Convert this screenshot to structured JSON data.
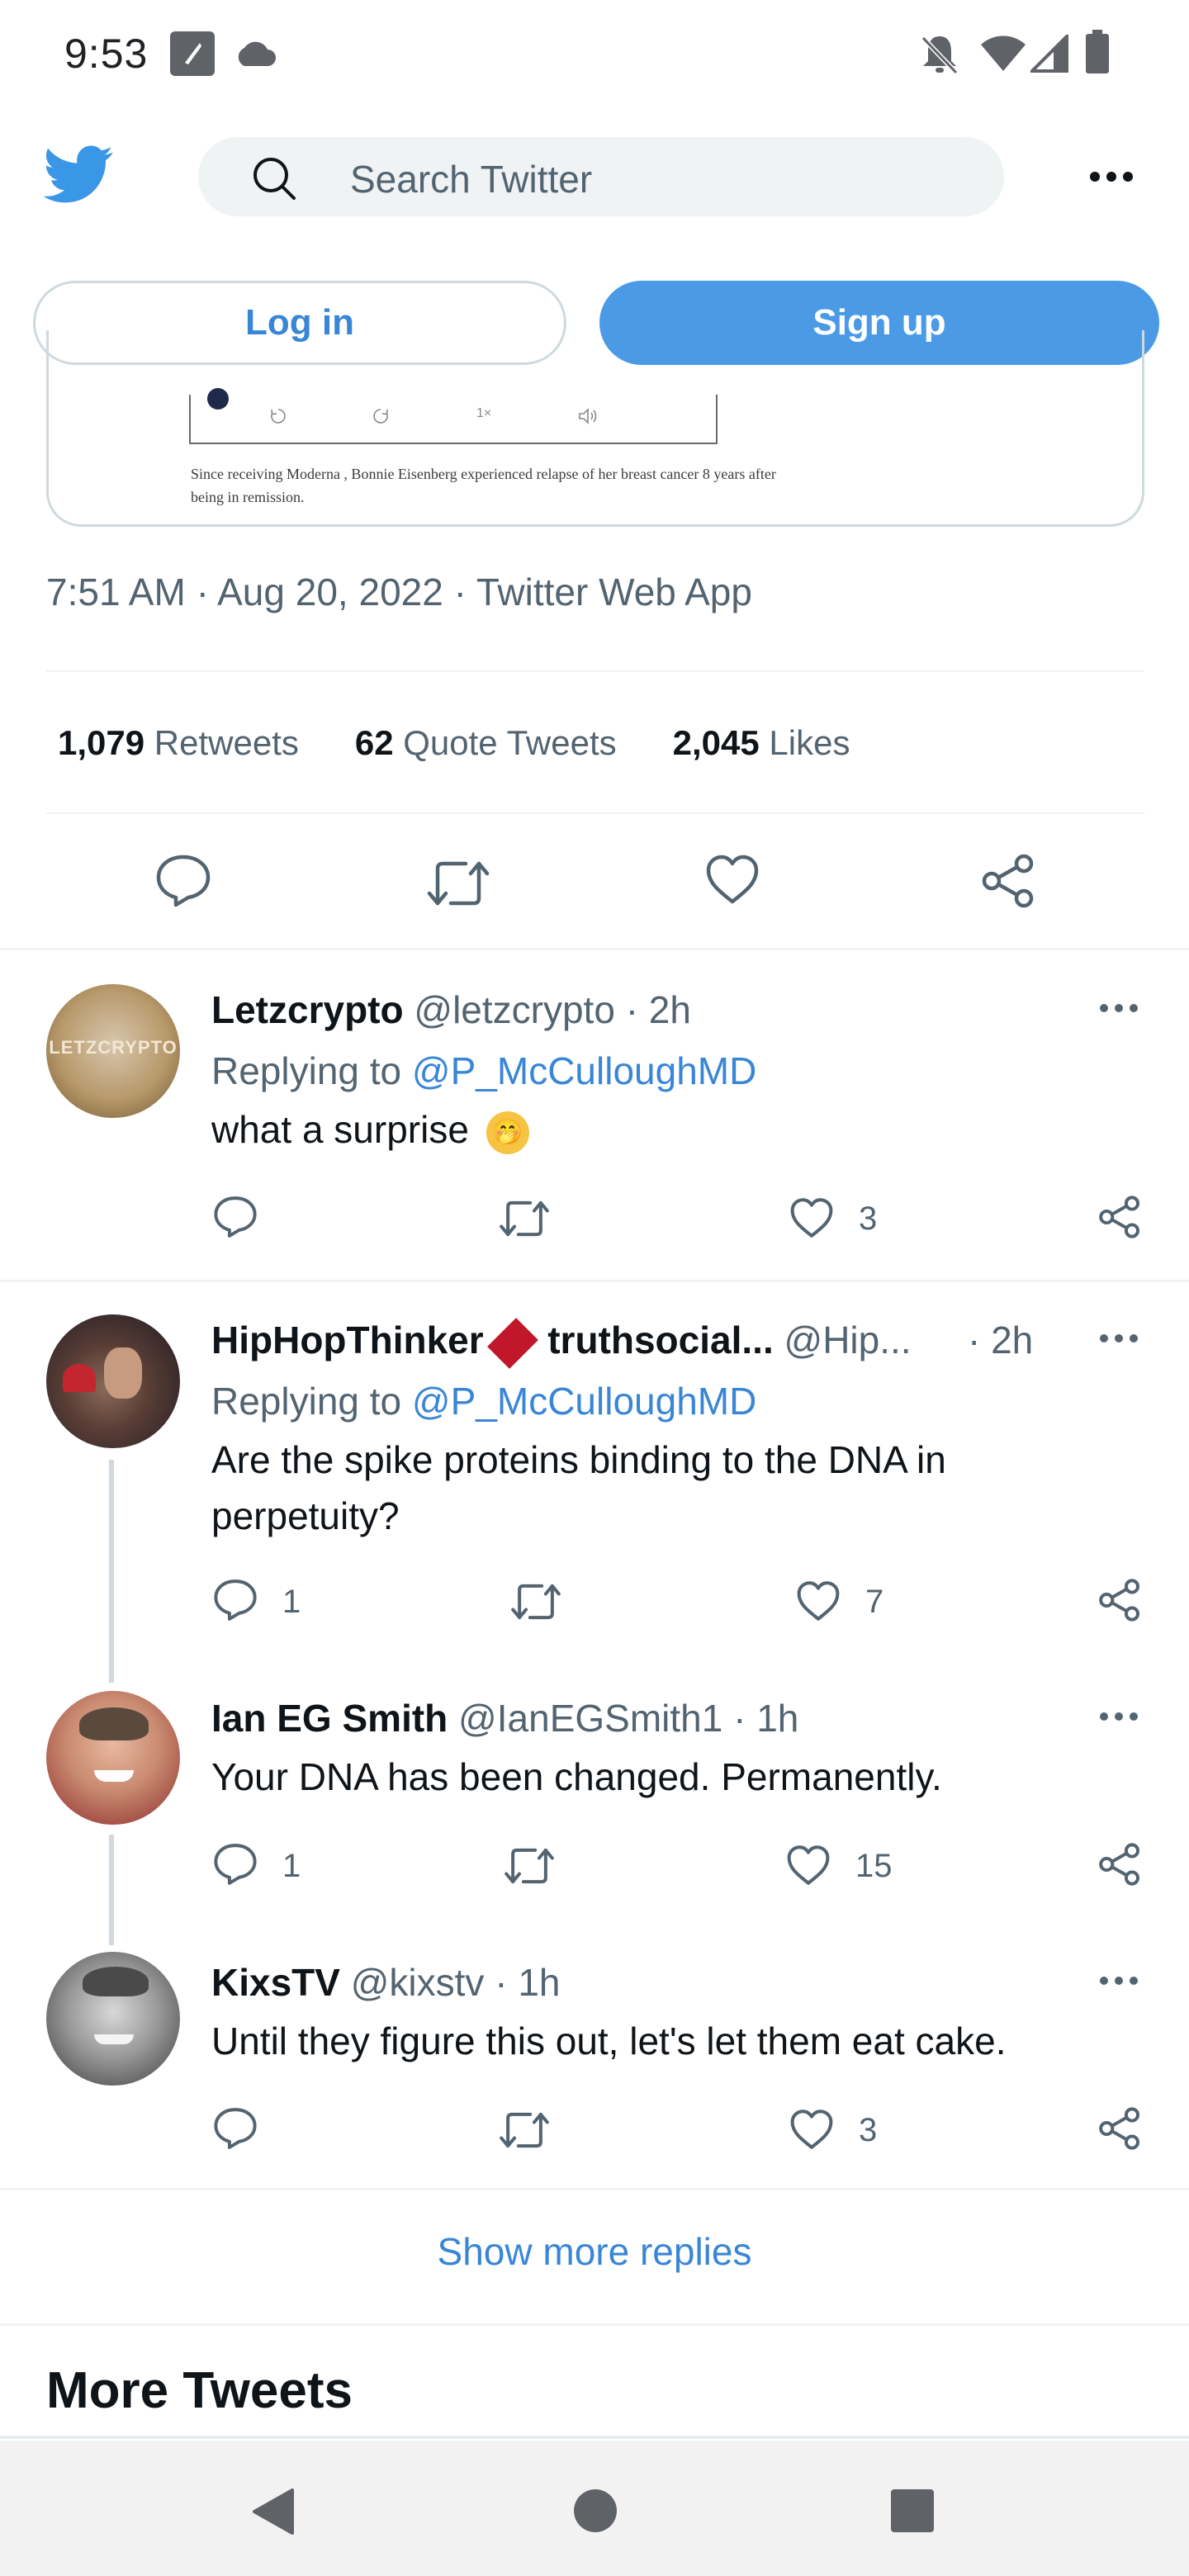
{
  "status_bar": {
    "time": "9:53",
    "icons": [
      "app-notification-icon",
      "cloud-icon",
      "notifications-off-icon",
      "wifi-icon",
      "signal-icon",
      "battery-icon"
    ]
  },
  "header": {
    "logo": "twitter-bird-icon",
    "search_placeholder": "Search Twitter",
    "more_icon": "more-horizontal-icon",
    "login_label": "Log in",
    "signup_label": "Sign up",
    "accent": "#4a9ae6"
  },
  "media_card": {
    "player_speed": "1×",
    "caption": "Since receiving Moderna                                     , Bonnie Eisenberg experienced relapse of her breast cancer 8 years after being in remission."
  },
  "tweet": {
    "time": "7:51 AM",
    "date": "Aug 20, 2022",
    "source": "Twitter Web App",
    "retweets_count": "1,079",
    "retweets_label": "Retweets",
    "quotes_count": "62",
    "quotes_label": "Quote Tweets",
    "likes_count": "2,045",
    "likes_label": "Likes"
  },
  "replies": [
    {
      "name": "Letzcrypto",
      "handle": "@letzcrypto",
      "time": "· 2h",
      "replying_prefix": "Replying to",
      "replying_to": "@P_McCulloughMD",
      "text": "what a surprise",
      "emoji": "🤭",
      "reply_count": "",
      "like_count": "3"
    },
    {
      "name": "HipHopThinker",
      "name_suffix": "truthsocial...",
      "handle": "@Hip...",
      "time": "· 2h",
      "replying_prefix": "Replying to",
      "replying_to": "@P_McCulloughMD",
      "text": "Are the spike proteins binding to the DNA in perpetuity?",
      "reply_count": "1",
      "like_count": "7"
    },
    {
      "name": "Ian EG Smith",
      "handle": "@IanEGSmith1",
      "time": "· 1h",
      "text": "Your DNA has been changed. Permanently.",
      "reply_count": "1",
      "like_count": "15"
    },
    {
      "name": "KixsTV",
      "handle": "@kixstv",
      "time": "· 1h",
      "text": "Until they figure this out, let's let them eat cake.",
      "reply_count": "",
      "like_count": "3"
    }
  ],
  "avatar_texts": {
    "letzcrypto": "LETZCRYPTO"
  },
  "show_more_label": "Show more replies",
  "more_tweets_label": "More Tweets",
  "nav": {
    "back_icon": "back-triangle-icon",
    "home_icon": "home-circle-icon",
    "recents_icon": "recents-square-icon"
  }
}
